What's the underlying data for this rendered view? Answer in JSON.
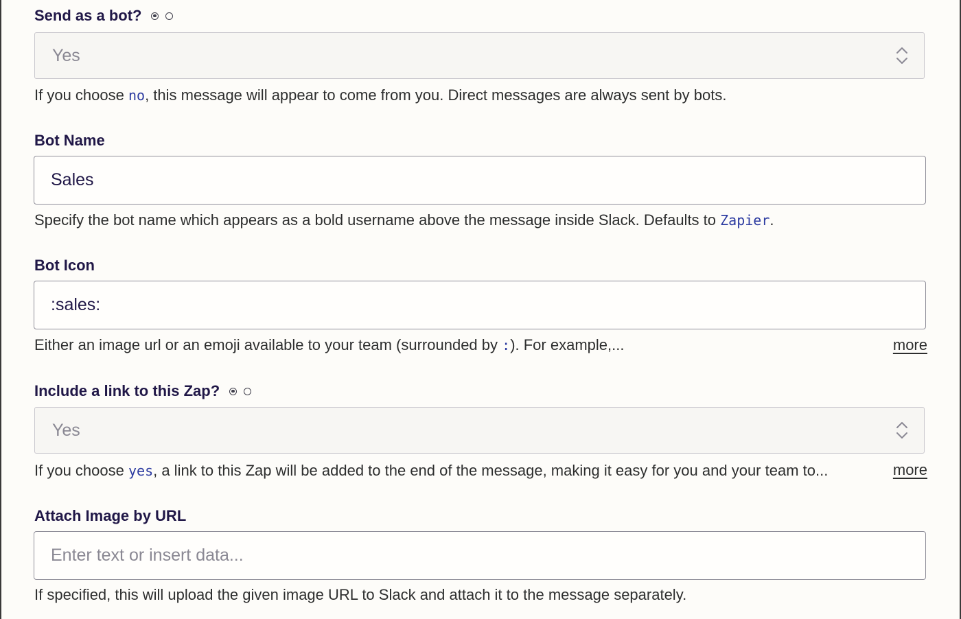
{
  "send_as_bot": {
    "label": "Send as a bot?",
    "radio_options": [
      "yes",
      "no"
    ],
    "selected_radio": "yes",
    "value": "Yes",
    "help_before": "If you choose ",
    "help_code": "no",
    "help_after": ", this message will appear to come from you. Direct messages are always sent by bots."
  },
  "bot_name": {
    "label": "Bot Name",
    "value": "Sales",
    "help_before": "Specify the bot name which appears as a bold username above the message inside Slack. Defaults to ",
    "help_code": "Zapier",
    "help_after": "."
  },
  "bot_icon": {
    "label": "Bot Icon",
    "value": ":sales:",
    "help_before": "Either an image url or an emoji available to your team (surrounded by ",
    "help_code": ":",
    "help_after": "). For example,...",
    "more_label": "more"
  },
  "include_link": {
    "label": "Include a link to this Zap?",
    "radio_options": [
      "yes",
      "no"
    ],
    "selected_radio": "yes",
    "value": "Yes",
    "help_before": "If you choose ",
    "help_code": "yes",
    "help_after": ", a link to this Zap will be added to the end of the message, making it easy for you and your team to...",
    "more_label": "more"
  },
  "attach_image": {
    "label": "Attach Image by URL",
    "placeholder": "Enter text or insert data...",
    "help": "If specified, this will upload the given image URL to Slack and attach it to the message separately."
  },
  "colors": {
    "background": "#fdfcf9",
    "label": "#201747",
    "code": "#2b3aa0",
    "select_bg": "#f7f6f3",
    "input_border": "#8f8e99"
  },
  "icons": {
    "select_chevron": "chevron-up-down-icon",
    "radio": "radio-button-icon"
  }
}
